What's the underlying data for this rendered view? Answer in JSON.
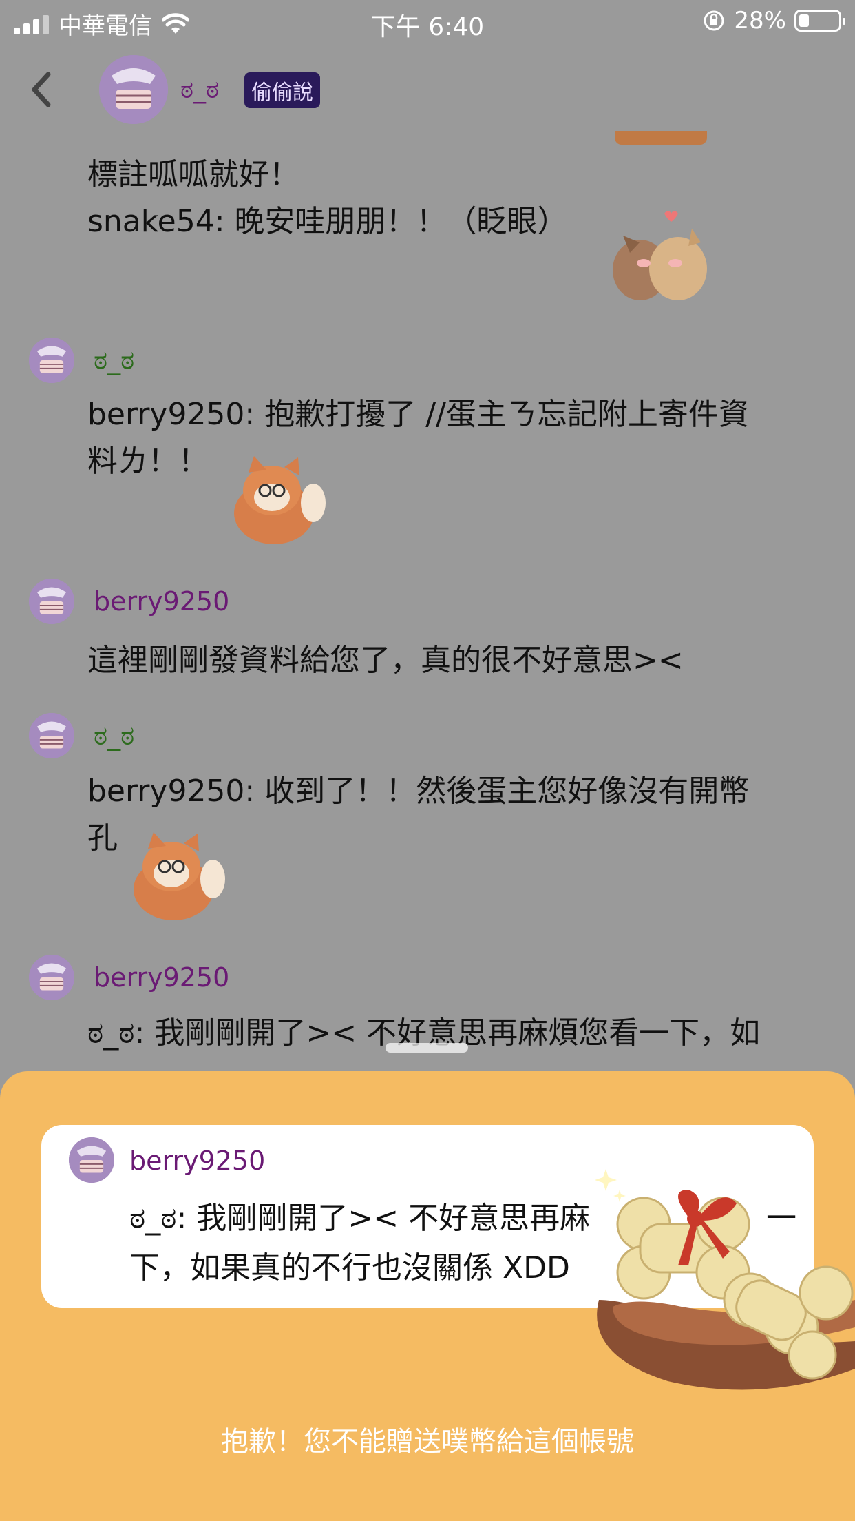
{
  "status_bar": {
    "carrier": "中華電信",
    "time": "下午 6:40",
    "battery": "28%",
    "battery_level": 0.28,
    "icons": [
      "signal-icon",
      "wifi-icon",
      "rotation-lock-icon",
      "battery-icon"
    ]
  },
  "header": {
    "back_icon": "chevron-left-icon",
    "username": "ಠ_ಠ",
    "badge": "偷偷說"
  },
  "messages": [
    {
      "lines": [
        "標註呱呱就好！",
        "snake54: 晚安哇朋朋！！（眨眼）"
      ],
      "sticker": "kissing-animals"
    },
    {
      "user": "ಠ_ಠ",
      "user_color": "#2c6b1c",
      "lines": [
        "berry9250: 抱歉打擾了 //蛋主ㄋ忘記附上寄件資",
        "料ㄌ！！"
      ],
      "sticker": "fox"
    },
    {
      "user": "berry9250",
      "user_color": "#6a1a74",
      "lines": [
        "這裡剛剛發資料給您了，真的很不好意思><"
      ]
    },
    {
      "user": "ಠ_ಠ",
      "user_color": "#2c6b1c",
      "lines": [
        "berry9250: 收到了！！然後蛋主您好像沒有開幣",
        "孔"
      ],
      "sticker": "fox"
    },
    {
      "user": "berry9250",
      "user_color": "#6a1a74",
      "lines": [
        "ಠ_ಠ: 我剛剛開了>< 不好意思再麻煩您看一下，如"
      ]
    }
  ],
  "sheet": {
    "card": {
      "user": "berry9250",
      "lines": [
        "ಠ_ಠ: 我剛剛開了>< 不好意思再麻",
        "下，如果真的不行也沒關係 XDD"
      ],
      "line1_tail": "一"
    },
    "notice": "抱歉！您不能贈送噗幣給這個帳號",
    "colors": {
      "background": "#f5bb62",
      "dim_overlay": "#9a9a9a",
      "username_purple": "#6a1a74",
      "username_green": "#2c6b1c"
    }
  }
}
